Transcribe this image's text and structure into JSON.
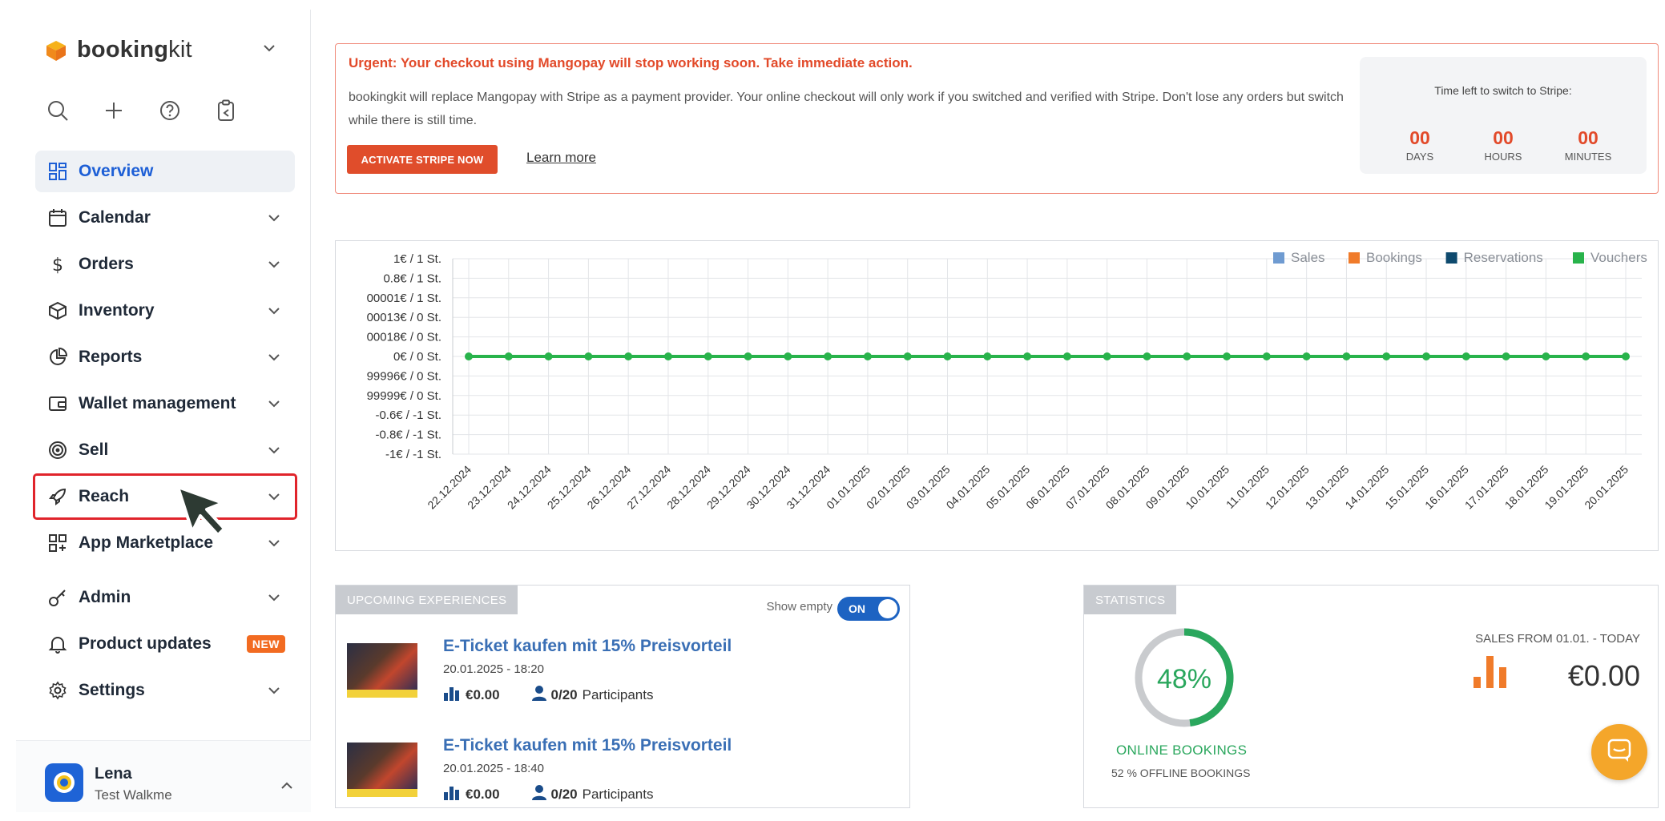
{
  "brand": {
    "name_bold": "booking",
    "name_light": "kit"
  },
  "nav": {
    "items": [
      {
        "label": "Overview",
        "icon": "grid-icon"
      },
      {
        "label": "Calendar",
        "icon": "calendar-icon"
      },
      {
        "label": "Orders",
        "icon": "dollar-icon"
      },
      {
        "label": "Inventory",
        "icon": "box-icon"
      },
      {
        "label": "Reports",
        "icon": "pie-chart-icon"
      },
      {
        "label": "Wallet management",
        "icon": "wallet-icon"
      },
      {
        "label": "Sell",
        "icon": "target-icon"
      },
      {
        "label": "Reach",
        "icon": "rocket-icon"
      },
      {
        "label": "App Marketplace",
        "icon": "apps-icon"
      },
      {
        "label": "Admin",
        "icon": "key-icon"
      },
      {
        "label": "Product updates",
        "icon": "bell-icon",
        "badge": "NEW"
      },
      {
        "label": "Settings",
        "icon": "gear-icon"
      }
    ]
  },
  "user": {
    "name": "Lena",
    "org": "Test Walkme"
  },
  "alert": {
    "title": "Urgent: Your checkout using Mangopay will stop working soon. Take immediate action.",
    "text": "bookingkit will replace Mangopay with Stripe as a payment provider. Your online checkout will only work if you switched and verified with Stripe. Don't lose any orders but switch while there is still time.",
    "button": "ACTIVATE STRIPE NOW",
    "link": "Learn more",
    "timer_title": "Time left to switch to Stripe:",
    "days_value": "00",
    "days_label": "DAYS",
    "hours_value": "00",
    "hours_label": "HOURS",
    "minutes_value": "00",
    "minutes_label": "MINUTES"
  },
  "chart_data": {
    "type": "line",
    "x": [
      "22.12.2024",
      "23.12.2024",
      "24.12.2024",
      "25.12.2024",
      "26.12.2024",
      "27.12.2024",
      "28.12.2024",
      "29.12.2024",
      "30.12.2024",
      "31.12.2024",
      "01.01.2025",
      "02.01.2025",
      "03.01.2025",
      "04.01.2025",
      "05.01.2025",
      "06.01.2025",
      "07.01.2025",
      "08.01.2025",
      "09.01.2025",
      "10.01.2025",
      "11.01.2025",
      "12.01.2025",
      "13.01.2025",
      "14.01.2025",
      "15.01.2025",
      "16.01.2025",
      "17.01.2025",
      "18.01.2025",
      "19.01.2025",
      "20.01.2025"
    ],
    "y_ticks": [
      "1€ / 1 St.",
      "0.8€ / 1 St.",
      "00001€ / 1 St.",
      "00013€ / 0 St.",
      "00018€ / 0 St.",
      "0€ / 0 St.",
      "99996€ / 0 St.",
      "99999€ / 0 St.",
      "-0.6€ / -1 St.",
      "-0.8€ / -1 St.",
      "-1€ / -1 St."
    ],
    "ylim": [
      -1,
      1
    ],
    "series": [
      {
        "name": "Sales",
        "color": "#6f9bd1",
        "values": [
          0,
          0,
          0,
          0,
          0,
          0,
          0,
          0,
          0,
          0,
          0,
          0,
          0,
          0,
          0,
          0,
          0,
          0,
          0,
          0,
          0,
          0,
          0,
          0,
          0,
          0,
          0,
          0,
          0,
          0
        ]
      },
      {
        "name": "Bookings",
        "color": "#f07b2a",
        "values": [
          0,
          0,
          0,
          0,
          0,
          0,
          0,
          0,
          0,
          0,
          0,
          0,
          0,
          0,
          0,
          0,
          0,
          0,
          0,
          0,
          0,
          0,
          0,
          0,
          0,
          0,
          0,
          0,
          0,
          0
        ]
      },
      {
        "name": "Reservations",
        "color": "#0e4a6e",
        "values": [
          0,
          0,
          0,
          0,
          0,
          0,
          0,
          0,
          0,
          0,
          0,
          0,
          0,
          0,
          0,
          0,
          0,
          0,
          0,
          0,
          0,
          0,
          0,
          0,
          0,
          0,
          0,
          0,
          0,
          0
        ]
      },
      {
        "name": "Vouchers",
        "color": "#28b34b",
        "values": [
          0,
          0,
          0,
          0,
          0,
          0,
          0,
          0,
          0,
          0,
          0,
          0,
          0,
          0,
          0,
          0,
          0,
          0,
          0,
          0,
          0,
          0,
          0,
          0,
          0,
          0,
          0,
          0,
          0,
          0
        ]
      }
    ],
    "legend_position": "top-right",
    "grid": true
  },
  "experiences": {
    "tab_label": "UPCOMING EXPERIENCES",
    "show_empty_label": "Show empty",
    "toggle_label": "ON",
    "items": [
      {
        "title": "E-Ticket kaufen mit 15% Preisvorteil",
        "date": "20.01.2025 - 18:20",
        "amount": "€0.00",
        "participants": "0/20",
        "participants_label": "Participants"
      },
      {
        "title": "E-Ticket kaufen mit 15% Preisvorteil",
        "date": "20.01.2025 - 18:40",
        "amount": "€0.00",
        "participants": "0/20",
        "participants_label": "Participants"
      }
    ]
  },
  "statistics": {
    "tab_label": "STATISTICS",
    "online_percent": 48,
    "online_percent_text": "48%",
    "online_label": "ONLINE BOOKINGS",
    "offline_label": "52 % OFFLINE BOOKINGS",
    "sales_label": "SALES FROM 01.01. - TODAY",
    "sales_value": "€0.00"
  }
}
